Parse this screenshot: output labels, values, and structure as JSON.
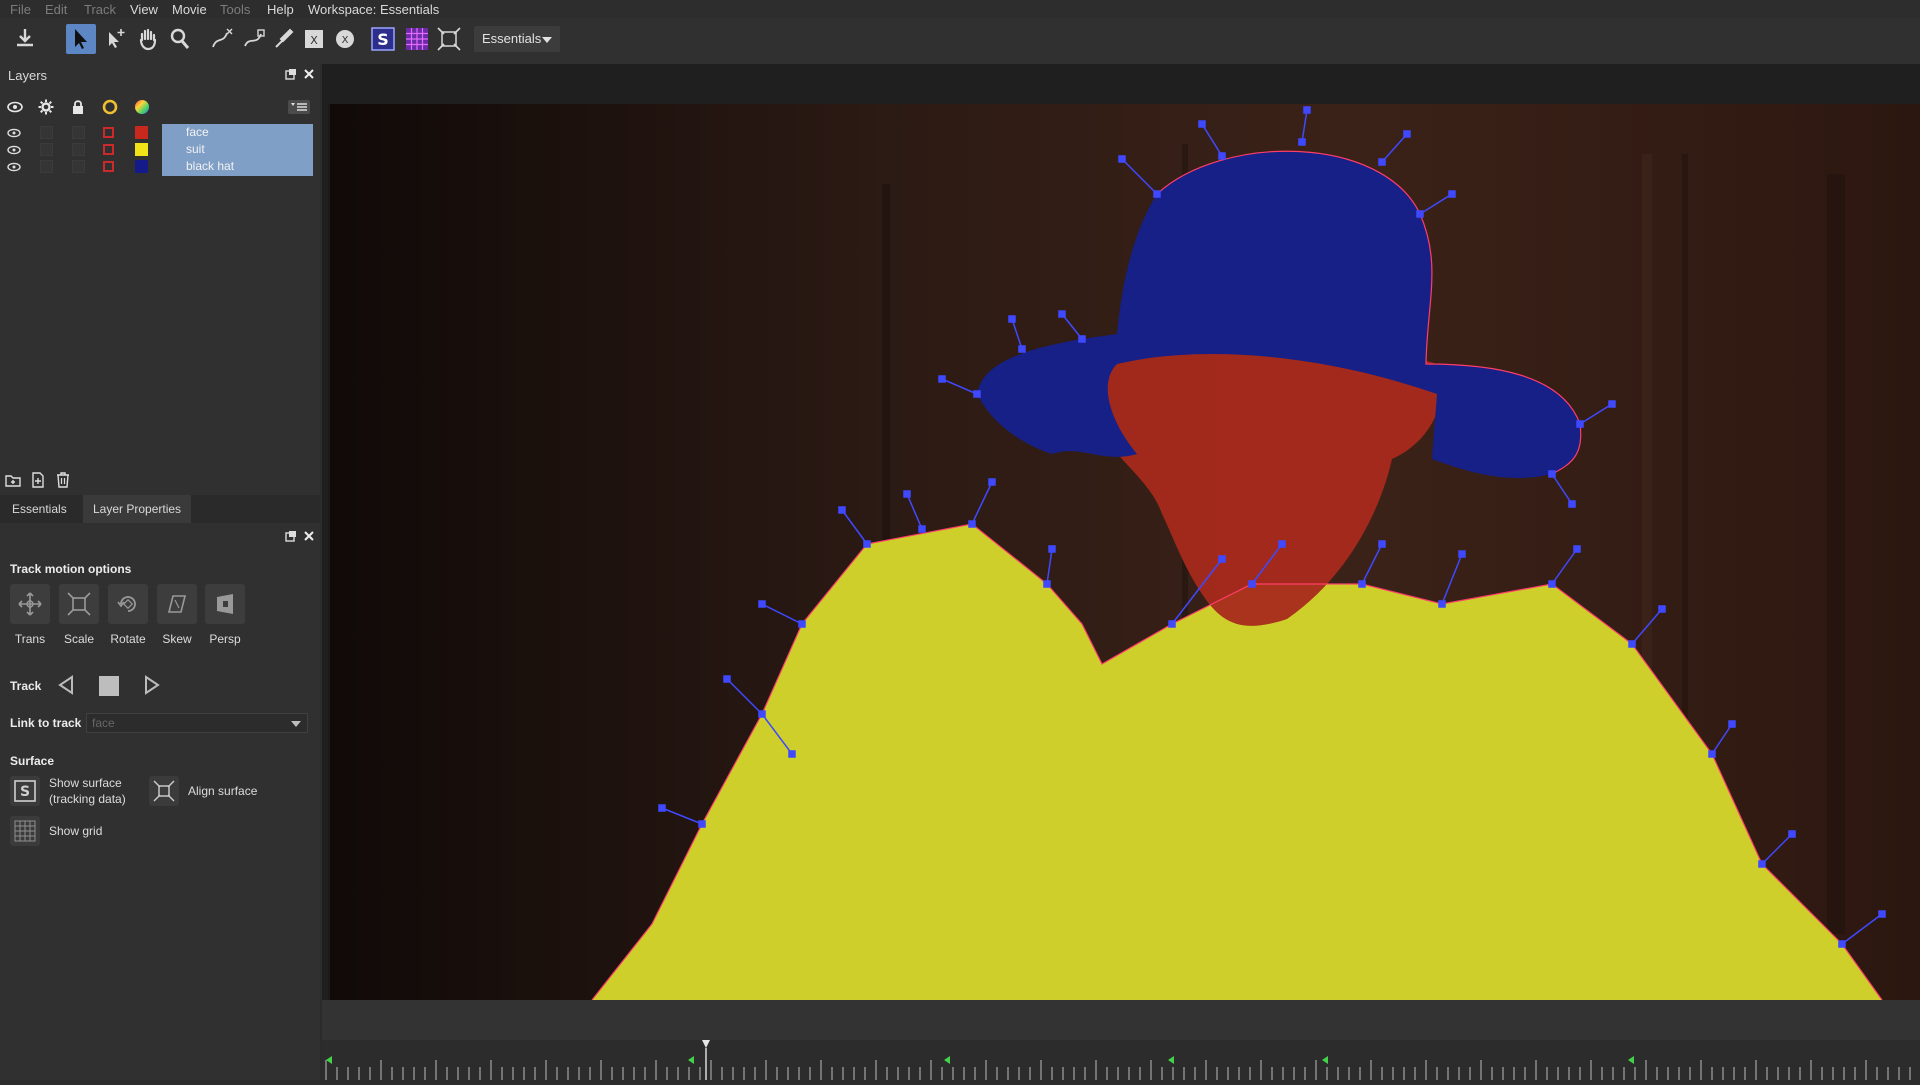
{
  "menu": {
    "items": [
      "File",
      "Edit",
      "Track",
      "View",
      "Movie",
      "Tools",
      "Help",
      "Workspace: Essentials"
    ],
    "dimmed": [
      true,
      true,
      true,
      false,
      false,
      true,
      false,
      false
    ]
  },
  "toolbar": {
    "workspace_dropdown": "Essentials",
    "tools": [
      "export-icon",
      "select-arrow-icon",
      "add-point-icon",
      "hand-pan-icon",
      "zoom-icon",
      "x-spline-icon",
      "bezier-icon",
      "brush-icon",
      "rectangle-icon",
      "ellipse-icon",
      "surface-S-icon",
      "grid-icon",
      "align-surface-icon"
    ],
    "active_tool": "select-arrow-icon"
  },
  "layers_panel": {
    "title": "Layers",
    "header_icons": [
      "eye-icon",
      "gear-icon",
      "lock-icon",
      "circle-color-icon",
      "color-wheel-icon"
    ],
    "layers": [
      {
        "name": "face",
        "color": "#c9281f"
      },
      {
        "name": "suit",
        "color": "#f2e218"
      },
      {
        "name": "black hat",
        "color": "#151a8a"
      }
    ],
    "selection_color": "#7f9fc6"
  },
  "tabs": {
    "items": [
      "Essentials",
      "Layer Properties"
    ],
    "active": "Layer Properties"
  },
  "properties": {
    "track_motion_title": "Track motion options",
    "motion_buttons": [
      "Trans",
      "Scale",
      "Rotate",
      "Skew",
      "Persp"
    ],
    "track_label": "Track",
    "link_to_track_label": "Link to track",
    "link_to_track_value": "face",
    "surface_title": "Surface",
    "show_surface_line1": "Show surface",
    "show_surface_line2": "(tracking data)",
    "align_surface": "Align surface",
    "show_grid": "Show grid"
  },
  "colors": {
    "accent": "#5d86c4",
    "hat": "#172188",
    "face": "#b42e1e",
    "suit": "#d5d32c",
    "spline": "#3f49ff"
  }
}
